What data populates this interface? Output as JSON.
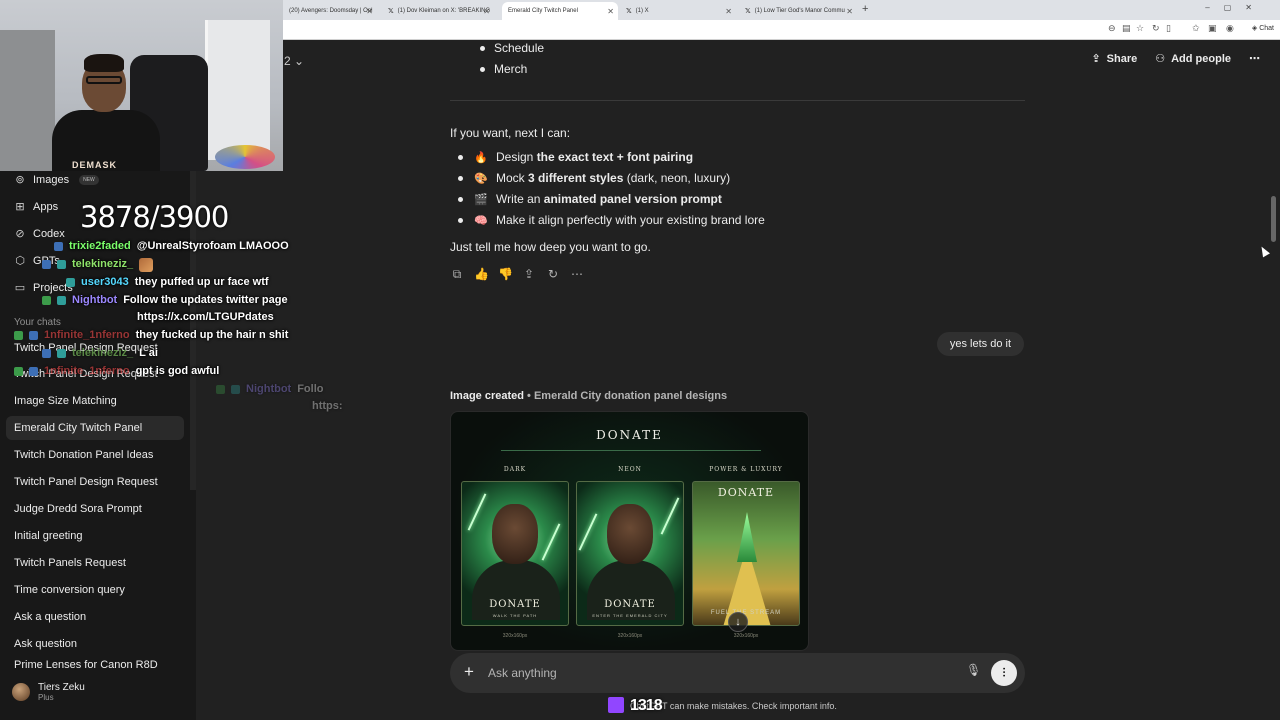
{
  "browser": {
    "tabs": [
      {
        "label": "(20) Avengers: Doomsday | Onl"
      },
      {
        "label": "(1) Dov Kleiman on X: 'BREAKING"
      },
      {
        "label": "Emerald City Twitch Panel",
        "active": true
      },
      {
        "label": "(1) X"
      },
      {
        "label": "(1) Low Tier God's Manor Commu"
      }
    ],
    "new_tab": "+",
    "chat_button": "Chat"
  },
  "sidebar": {
    "nav": [
      {
        "label": "Images",
        "badge": "NEW",
        "icon": "images-icon"
      },
      {
        "label": "Apps",
        "icon": "apps-icon"
      },
      {
        "label": "Codex",
        "icon": "codex-icon"
      },
      {
        "label": "GPTs",
        "icon": "gpts-icon"
      },
      {
        "label": "Projects",
        "icon": "projects-icon"
      }
    ],
    "chats_title": "Your chats",
    "chats": [
      "Twitch Panel Design Request",
      "Twitch Panel Design Request",
      "Image Size Matching",
      "Emerald City Twitch Panel",
      "Twitch Donation Panel Ideas",
      "Twitch Panel Design Request",
      "Judge Dredd Sora Prompt",
      "Initial greeting",
      "Twitch Panels Request",
      "Time conversion query",
      "Ask a question",
      "Ask question",
      "Prime Lenses for Canon R8D"
    ],
    "user": {
      "name": "Tiers Zeku",
      "plan": "Plus"
    }
  },
  "stream": {
    "counter": "3878/3900",
    "chat": [
      {
        "user": "trixie2faded",
        "user_color": "#7cff6b",
        "msg": "@UnrealStyrofoam LMAOOO"
      },
      {
        "user": "telekineziz_",
        "user_color": "#8fe36a",
        "msg": ""
      },
      {
        "user": "user3043",
        "user_color": "#55d9ff",
        "msg": "they puffed up ur face wtf"
      },
      {
        "user": "Nightbot",
        "user_color": "#9c88ff",
        "msg": "Follow the updates twitter page"
      },
      {
        "user": "",
        "user_color": "#ffffff",
        "msg": "https://x.com/LTGUPdates"
      },
      {
        "user": "1nfinite_1nferno",
        "user_color": "#ff4b4b",
        "msg": "they fucked up the hair n shit"
      },
      {
        "user": "telekineziz_",
        "user_color": "#8fe36a",
        "msg": "L ai"
      },
      {
        "user": "1nfinite_1nferno",
        "user_color": "#ff4b4b",
        "msg": "gpt is god awful"
      }
    ],
    "faded_chat": {
      "user": "Nightbot",
      "msg1": "Follo",
      "msg2": "https:"
    },
    "twitch_count": "1318",
    "webcam_print": "DEMASK"
  },
  "header": {
    "model_fragment": "2 ⌄",
    "share": "Share",
    "add_people": "Add people",
    "more": "⋯"
  },
  "conversation": {
    "top_bullets": [
      "Schedule",
      "Merch"
    ],
    "intro": "If you want, next I can:",
    "options": [
      {
        "emoji": "🔥",
        "pre": "Design ",
        "bold": "the exact text + font pairing",
        "post": ""
      },
      {
        "emoji": "🎨",
        "pre": "Mock ",
        "bold": "3 different styles",
        "post": " (dark, neon, luxury)"
      },
      {
        "emoji": "🎬",
        "pre": "Write an ",
        "bold": "animated panel version prompt",
        "post": ""
      },
      {
        "emoji": "🧠",
        "pre": "Make it align perfectly with your existing brand lore",
        "bold": "",
        "post": ""
      }
    ],
    "outro": "Just tell me how deep you want to go.",
    "user_message": "yes lets do it",
    "image_title": "Image created",
    "image_subtitle": "Emerald City donation panel designs"
  },
  "generated_image": {
    "title": "DONATE",
    "columns": [
      {
        "label": "DARK",
        "button": "DONATE",
        "sub": "WALK THE PATH",
        "size": "320x160px"
      },
      {
        "label": "NEON",
        "button": "DONATE",
        "sub": "ENTER THE EMERALD CITY",
        "size": "320x160px"
      },
      {
        "label": "POWER & LUXURY",
        "button": "DONATE",
        "sub": "FUEL THE STREAM",
        "size": "320x160px"
      }
    ]
  },
  "composer": {
    "placeholder": "Ask anything",
    "disclaimer": "ChatGPT can make mistakes. Check important info."
  }
}
